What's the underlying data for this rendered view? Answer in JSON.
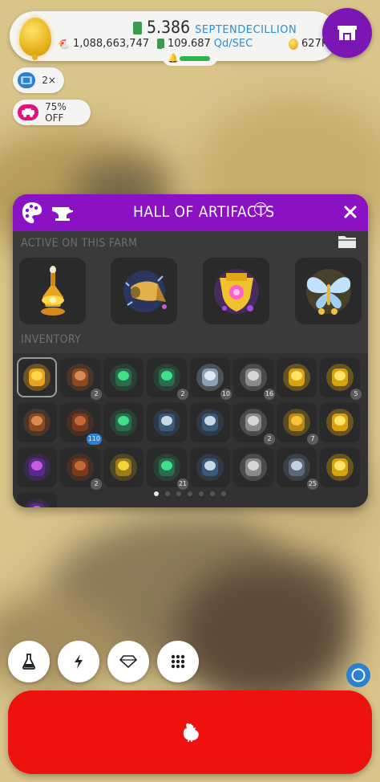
{
  "status": {
    "cash_value": "5.386",
    "cash_unit": "SEPTENDECILLION",
    "chicken_count": "1,088,663,747",
    "earning_rate_value": "109.687",
    "earning_rate_unit": "Qd/SEC",
    "golden_eggs": "627K"
  },
  "boosts": [
    {
      "label": "2×",
      "color": "#2d7fd1"
    },
    {
      "label": "75% OFF",
      "color": "#e3127b"
    }
  ],
  "panel": {
    "title": "HALL OF ARTIFACTS",
    "info_glyph": "i",
    "active_label": "ACTIVE ON THIS FARM",
    "inventory_label": "INVENTORY",
    "accent_color": "#8a12c4",
    "active_artifacts": [
      "golden-vial-icon",
      "horn-artifact-icon",
      "shield-gem-icon",
      "crystal-butterfly-icon"
    ],
    "inventory": [
      {
        "icon": "vial-icon",
        "count": ""
      },
      {
        "icon": "book-icon",
        "count": "2"
      },
      {
        "icon": "ufo-green-icon",
        "count": ""
      },
      {
        "icon": "ufo-green-icon",
        "count": "2"
      },
      {
        "icon": "capsule-icon",
        "count": "10"
      },
      {
        "icon": "syringe-icon",
        "count": "16"
      },
      {
        "icon": "gold-statue-icon",
        "count": ""
      },
      {
        "icon": "gold-statue-icon",
        "count": "5"
      },
      {
        "icon": "book-icon",
        "count": ""
      },
      {
        "icon": "book-chick-icon",
        "count": "110"
      },
      {
        "icon": "ufo-green-icon",
        "count": ""
      },
      {
        "icon": "ufo-ring-icon",
        "count": ""
      },
      {
        "icon": "ufo-ring-icon",
        "count": ""
      },
      {
        "icon": "syringe-icon",
        "count": "2"
      },
      {
        "icon": "rings-icon",
        "count": "7"
      },
      {
        "icon": "gold-statue-icon",
        "count": ""
      },
      {
        "icon": "purple-statue-icon",
        "count": ""
      },
      {
        "icon": "book-chick-icon",
        "count": "2"
      },
      {
        "icon": "beetle-icon",
        "count": ""
      },
      {
        "icon": "ufo-green-icon",
        "count": "21"
      },
      {
        "icon": "ufo-ring-icon",
        "count": ""
      },
      {
        "icon": "syringe-icon",
        "count": ""
      },
      {
        "icon": "tube-icon",
        "count": "25"
      },
      {
        "icon": "gold-statue-icon",
        "count": ""
      },
      {
        "icon": "purple-statue-icon",
        "count": ""
      }
    ],
    "page_count": 7,
    "current_page": 1
  },
  "bottom": {
    "buttons": [
      "research-flask-icon",
      "boost-lightning-icon",
      "artifact-gem-icon",
      "menu-grid-icon"
    ],
    "hatch_color": "#ee120e"
  }
}
